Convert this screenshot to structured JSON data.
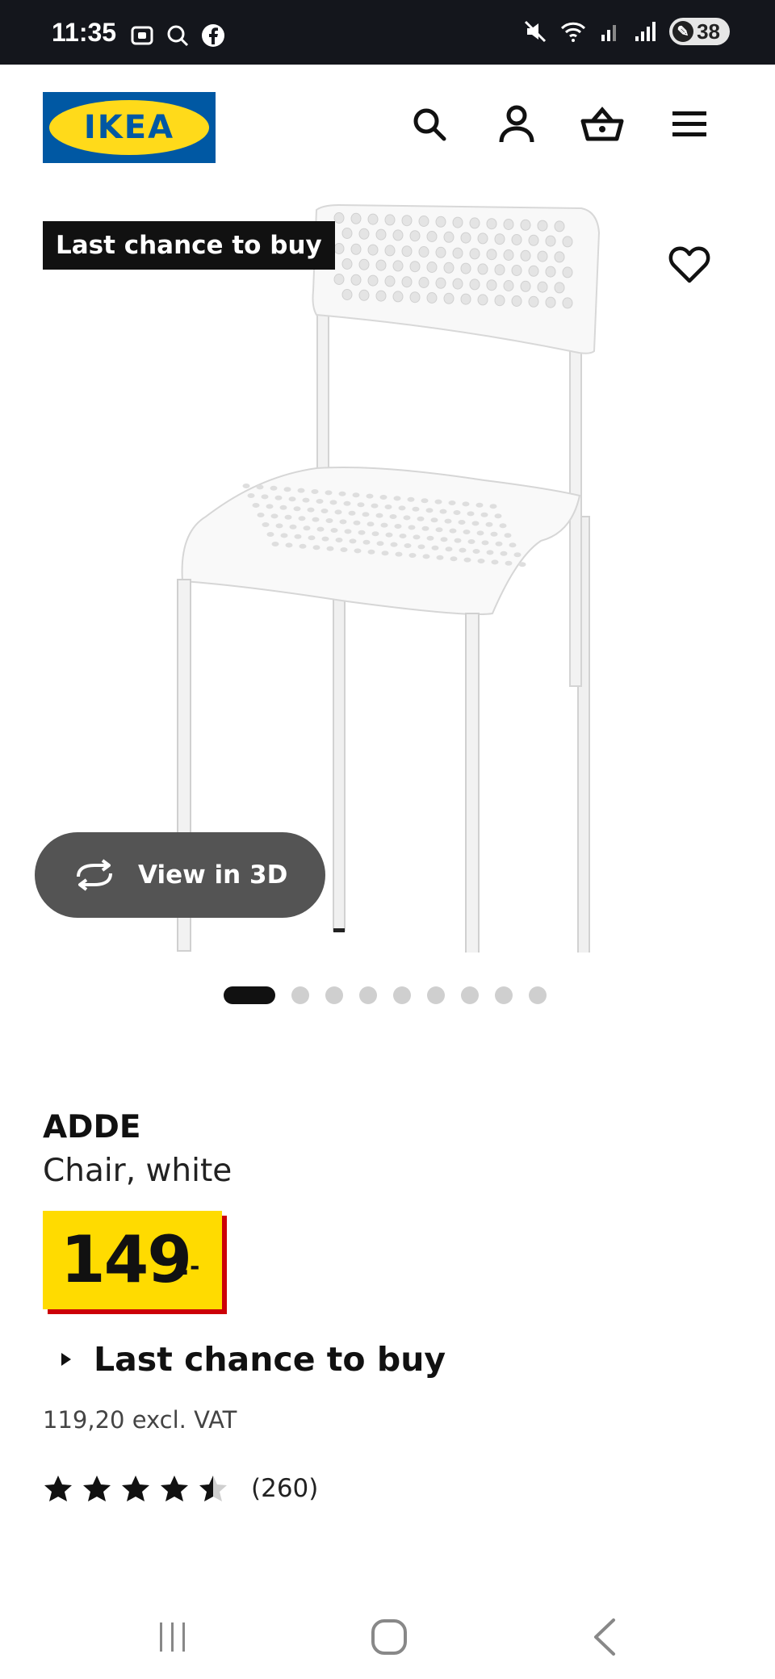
{
  "status": {
    "time": "11:35",
    "battery": "38"
  },
  "product": {
    "badge": "Last chance to buy",
    "view3d_label": "View in 3D",
    "image_count": 9,
    "active_image": 1,
    "name": "ADDE",
    "description": "Chair, white",
    "price": "149",
    "price_suffix": ":-",
    "availability": "Last chance to buy",
    "price_excl_vat": "119,20 excl. VAT",
    "rating": 4.5,
    "rating_count": "(260)"
  },
  "brand": {
    "logo_text": "IKEA",
    "blue": "#0058a3",
    "yellow": "#ffda1a",
    "price_yellow": "#ffdb00",
    "price_red": "#cc0008"
  },
  "icons": {
    "header": [
      "search-icon",
      "account-icon",
      "basket-icon",
      "menu-icon"
    ],
    "navbar": [
      "recents-icon",
      "home-icon",
      "back-icon"
    ]
  }
}
